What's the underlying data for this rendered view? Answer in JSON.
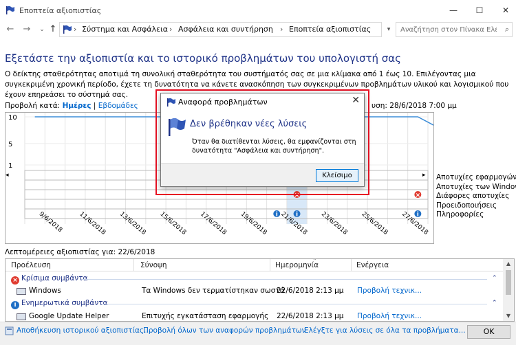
{
  "window": {
    "title": "Εποπτεία αξιοπιστίας",
    "minimize": "—",
    "maximize": "☐",
    "close": "✕"
  },
  "nav": {
    "back": "←",
    "forward": "→",
    "up": "↑",
    "breadcrumbs": [
      "Σύστημα και Ασφάλεια",
      "Ασφάλεια και συντήρηση",
      "Εποπτεία αξιοπιστίας"
    ],
    "search_placeholder": "Αναζήτηση στον Πίνακα Ελέγ..."
  },
  "main": {
    "heading": "Εξετάστε την αξιοπιστία και το ιστορικό προβλημάτων του υπολογιστή σας",
    "description": "Ο δείκτης σταθερότητας αποτιμά τη συνολική σταθερότητα του συστήματός σας σε μια κλίμακα από 1 έως 10. Επιλέγοντας μια συγκεκριμένη χρονική περίοδο, έχετε τη δυνατότητα να κάνετε ανασκόπηση των συγκεκριμένων προβλημάτων υλικού και λογισμικού που έχουν επηρεάσει το σύστημά σας.",
    "view_by_label": "Προβολή κατά:",
    "view_days": "Ημέρες",
    "view_sep": "|",
    "view_weeks": "Εβδομάδες",
    "last_updated": "υση: 28/6/2018 7:00 μμ"
  },
  "chart_data": {
    "type": "line",
    "y_ticks": [
      "10",
      "5",
      "1"
    ],
    "ylim": [
      1,
      10
    ],
    "x_labels": [
      "9/6/2018",
      "11/6/2018",
      "13/6/2018",
      "15/6/2018",
      "17/6/2018",
      "19/6/2018",
      "21/6/2018",
      "23/6/2018",
      "25/6/2018",
      "27/6/2018"
    ],
    "stability_index": [
      10,
      10,
      10,
      10,
      10,
      10,
      10,
      10,
      10,
      10,
      10,
      10,
      10,
      10,
      10,
      10,
      10,
      10,
      10,
      10,
      8
    ],
    "legend": [
      "Αποτυχίες εφαρμογών",
      "Αποτυχίες των Windows",
      "Διάφορες αποτυχίες",
      "Προειδοποιήσεις",
      "Πληροφορίες"
    ],
    "events": [
      {
        "col": 13,
        "row": 2,
        "kind": "critical"
      },
      {
        "col": 19,
        "row": 2,
        "kind": "critical"
      },
      {
        "col": 12,
        "row": 4,
        "kind": "info"
      },
      {
        "col": 13,
        "row": 4,
        "kind": "info"
      },
      {
        "col": 19,
        "row": 4,
        "kind": "info"
      }
    ],
    "selected_col": 13,
    "colors": {
      "line": "#3c8dd8",
      "critical": "#e03c31",
      "info": "#1f6fc5"
    }
  },
  "details": {
    "label": "Λεπτομέρειες αξιοπιστίας για: 22/6/2018",
    "columns": [
      "Προέλευση",
      "Σύνοψη",
      "Ημερομηνία",
      "Ενέργεια"
    ],
    "groups": [
      {
        "title": "Κρίσιμα συμβάντα",
        "icon": "×",
        "color": "#e03c31",
        "rows": [
          {
            "source": "Windows",
            "summary": "Τα Windows δεν τερματίστηκαν σωστά",
            "date": "22/6/2018 2:13 μμ",
            "action": "Προβολή τεχνικ..."
          }
        ]
      },
      {
        "title": "Ενημερωτικά συμβάντα",
        "icon": "i",
        "color": "#1f6fc5",
        "rows": [
          {
            "source": "Google Update Helper",
            "summary": "Επιτυχής εγκατάσταση εφαρμογής",
            "date": "22/6/2018 2:13 μμ",
            "action": "Προβολή τεχνικ..."
          }
        ]
      }
    ]
  },
  "footer": {
    "save_link": "Αποθήκευση ιστορικού αξιοπιστίας...",
    "all_reports_link": "Προβολή όλων των αναφορών προβλημάτων",
    "check_solutions_link": "Ελέγξτε για λύσεις σε όλα τα προβλήματα...",
    "ok": "OK"
  },
  "dialog": {
    "title": "Αναφορά προβλημάτων",
    "close": "✕",
    "heading": "Δεν βρέθηκαν νέες λύσεις",
    "message": "Όταν θα διατίθενται λύσεις, θα εμφανίζονται στη δυνατότητα \"Ασφάλεια και συντήρηση\".",
    "button": "Κλείσιμο",
    "highlight_color": "#e81123"
  }
}
